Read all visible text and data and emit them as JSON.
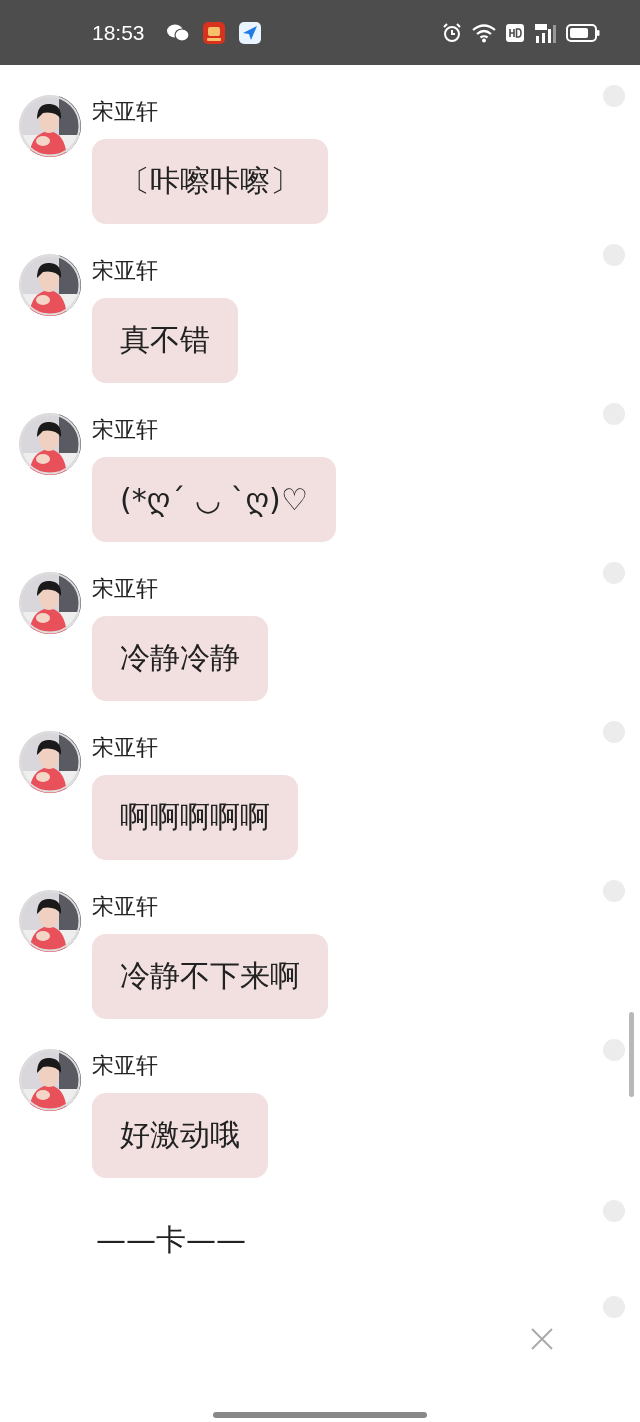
{
  "status_bar": {
    "time": "18:53"
  },
  "messages": [
    {
      "kind": "bubble",
      "sender": "宋亚轩",
      "text": "〔咔嚓咔嚓〕",
      "selected": false
    },
    {
      "kind": "bubble",
      "sender": "宋亚轩",
      "text": "真不错",
      "selected": false
    },
    {
      "kind": "bubble",
      "sender": "宋亚轩",
      "text": "(*ღ´ ◡ `ღ)♡",
      "selected": false
    },
    {
      "kind": "bubble",
      "sender": "宋亚轩",
      "text": "冷静冷静",
      "selected": false
    },
    {
      "kind": "bubble",
      "sender": "宋亚轩",
      "text": "啊啊啊啊啊",
      "selected": false
    },
    {
      "kind": "bubble",
      "sender": "宋亚轩",
      "text": "冷静不下来啊",
      "selected": false
    },
    {
      "kind": "bubble",
      "sender": "宋亚轩",
      "text": "好激动哦",
      "selected": false
    },
    {
      "kind": "plain",
      "text": "——卡——",
      "selected": false
    },
    {
      "kind": "cut",
      "selected": false
    }
  ]
}
